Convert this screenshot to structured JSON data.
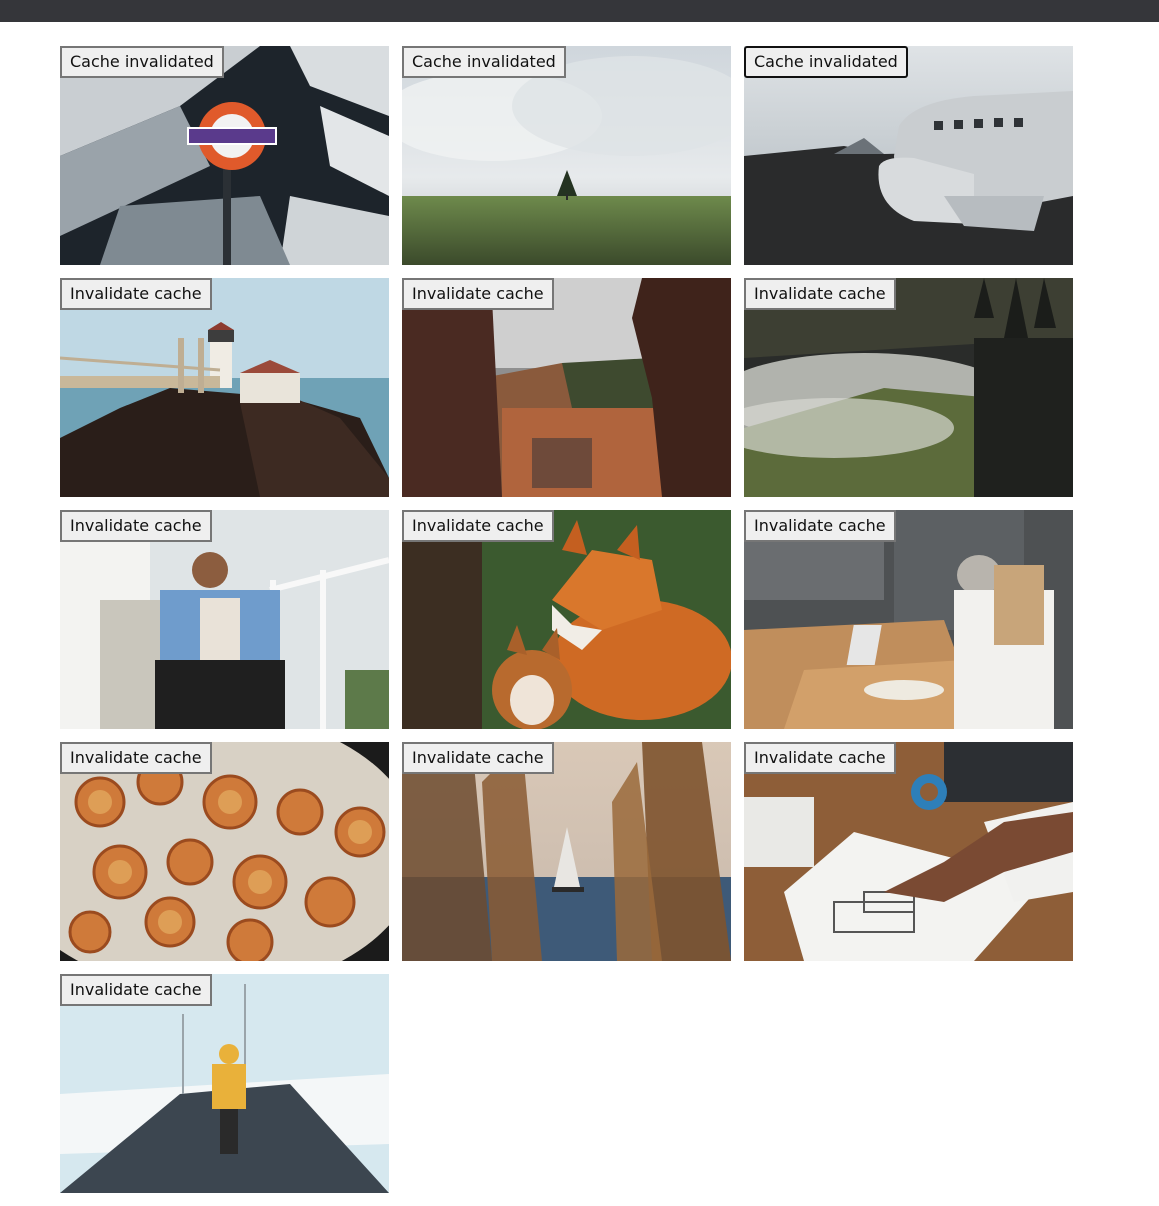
{
  "tiles": [
    {
      "label": "Cache invalidated",
      "image": "london-underground-sign-icon"
    },
    {
      "label": "Cache invalidated",
      "image": "lone-tree-cloudy-field-icon"
    },
    {
      "label": "Cache invalidated",
      "image": "plane-wreck-black-beach-icon"
    },
    {
      "label": "Invalidate cache",
      "image": "lighthouse-bridge-cliff-icon"
    },
    {
      "label": "Invalidate cache",
      "image": "town-view-through-rocks-icon"
    },
    {
      "label": "Invalidate cache",
      "image": "misty-forest-hill-icon"
    },
    {
      "label": "Invalidate cache",
      "image": "man-sitting-stairs-icon"
    },
    {
      "label": "Invalidate cache",
      "image": "foxes-icon"
    },
    {
      "label": "Invalidate cache",
      "image": "people-working-cafe-icon"
    },
    {
      "label": "Invalidate cache",
      "image": "dried-citrus-slices-icon"
    },
    {
      "label": "Invalidate cache",
      "image": "sailboat-sea-icon"
    },
    {
      "label": "Invalidate cache",
      "image": "architect-sketch-desk-icon"
    },
    {
      "label": "Invalidate cache",
      "image": "person-yellow-jacket-snowy-road-icon"
    }
  ],
  "colors": {
    "topbar": "#35363a",
    "button_bg": "#efefef",
    "button_border": "#767676"
  }
}
